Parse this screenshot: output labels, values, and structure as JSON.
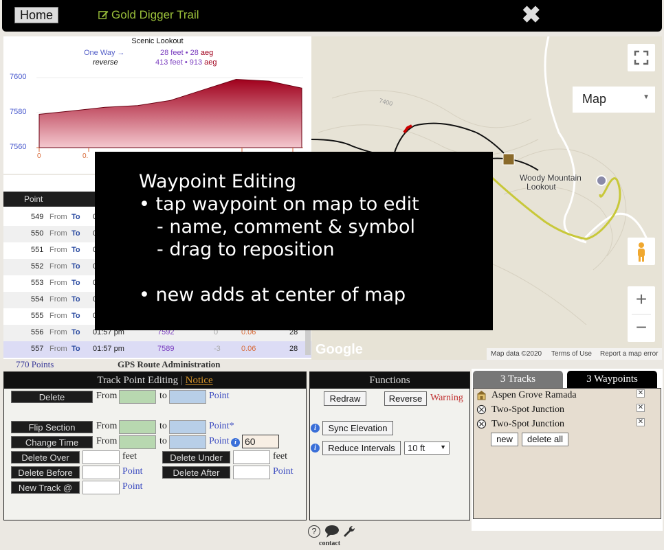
{
  "topbar": {
    "home_label": "Home",
    "trail_title": "Gold Digger Trail",
    "close_glyph": "✖"
  },
  "elevation": {
    "title": "Scenic Lookout",
    "one_way_label": "One Way →",
    "reverse_label": "reverse",
    "one_way_value": "28 feet • 28",
    "reverse_value": "413 feet • 913",
    "aeg_label": "aeg",
    "chart_data": {
      "type": "area",
      "y_ticks": [
        "7600",
        "7580",
        "7560"
      ],
      "x_ticks": [
        "0",
        "0."
      ],
      "ylim": [
        7552,
        7608
      ],
      "x": [
        0,
        1,
        2,
        3,
        4,
        5,
        6,
        7,
        8
      ],
      "values": [
        7579,
        7581,
        7583,
        7584,
        7587,
        7593,
        7599,
        7598,
        7594
      ],
      "fill_top": "#a0001c",
      "fill_bottom": "#f4c8cf"
    }
  },
  "table": {
    "header_point": "Point",
    "rows": [
      {
        "point": "549",
        "from": "From",
        "to": "To",
        "time": "0",
        "elev": "",
        "grade": "",
        "dist": "",
        "cum": ""
      },
      {
        "point": "550",
        "from": "From",
        "to": "To",
        "time": "0",
        "elev": "",
        "grade": "",
        "dist": "",
        "cum": ""
      },
      {
        "point": "551",
        "from": "From",
        "to": "To",
        "time": "0",
        "elev": "",
        "grade": "",
        "dist": "",
        "cum": ""
      },
      {
        "point": "552",
        "from": "From",
        "to": "To",
        "time": "0",
        "elev": "",
        "grade": "",
        "dist": "",
        "cum": ""
      },
      {
        "point": "553",
        "from": "From",
        "to": "To",
        "time": "0",
        "elev": "",
        "grade": "",
        "dist": "",
        "cum": ""
      },
      {
        "point": "554",
        "from": "From",
        "to": "To",
        "time": "0",
        "elev": "",
        "grade": "",
        "dist": "",
        "cum": ""
      },
      {
        "point": "555",
        "from": "From",
        "to": "To",
        "time": "0",
        "elev": "",
        "grade": "",
        "dist": "",
        "cum": ""
      },
      {
        "point": "556",
        "from": "From",
        "to": "To",
        "time": "01:57 pm",
        "elev": "7592",
        "grade": "0",
        "dist": "0.06",
        "cum": "28"
      },
      {
        "point": "557",
        "from": "From",
        "to": "To",
        "time": "01:57 pm",
        "elev": "7589",
        "grade": "-3",
        "dist": "0.06",
        "cum": "28"
      }
    ]
  },
  "map": {
    "map_type": "Map",
    "lookout_label_1": "Woody Mountain",
    "lookout_label_2": "Lookout",
    "contour_label": "7400",
    "google": "Google",
    "footer_data": "Map data ©2020",
    "footer_terms": "Terms of Use",
    "footer_report": "Report a map error"
  },
  "status": {
    "points": "770 Points",
    "admin_title": "GPS Route Administration"
  },
  "track_editing": {
    "title": "Track Point Editing",
    "separator": " | ",
    "notice": "Notice",
    "delete": "Delete",
    "flip_section": "Flip Section",
    "change_time": "Change Time",
    "delete_over": "Delete Over",
    "delete_under": "Delete Under",
    "delete_before": "Delete Before",
    "delete_after": "Delete After",
    "new_track": "New Track @",
    "from": "From",
    "to": "to",
    "point": "Point",
    "point_star": "Point*",
    "feet": "feet",
    "change_time_value": "60"
  },
  "functions": {
    "title": "Functions",
    "redraw": "Redraw",
    "reverse": "Reverse",
    "warning": "Warning",
    "sync_elevation": "Sync Elevation",
    "reduce_intervals": "Reduce Intervals",
    "interval_value": "10 ft"
  },
  "waypoints": {
    "tab_tracks": "3 Tracks",
    "tab_waypoints": "3 Waypoints",
    "items": [
      {
        "name": "Aspen Grove Ramada",
        "icon": "ramada-icon"
      },
      {
        "name": "Two-Spot Junction",
        "icon": "junction-icon"
      },
      {
        "name": "Two-Spot Junction",
        "icon": "junction-icon"
      }
    ],
    "new_label": "new",
    "delete_all_label": "delete all"
  },
  "footer": {
    "help": "?",
    "contact": "contact"
  },
  "tutorial": {
    "line1": "Waypoint Editing",
    "line2": "• tap waypoint on map to edit",
    "line3": "- name, comment & symbol",
    "line4": "- drag to reposition",
    "line5": "• new adds at center of map"
  }
}
